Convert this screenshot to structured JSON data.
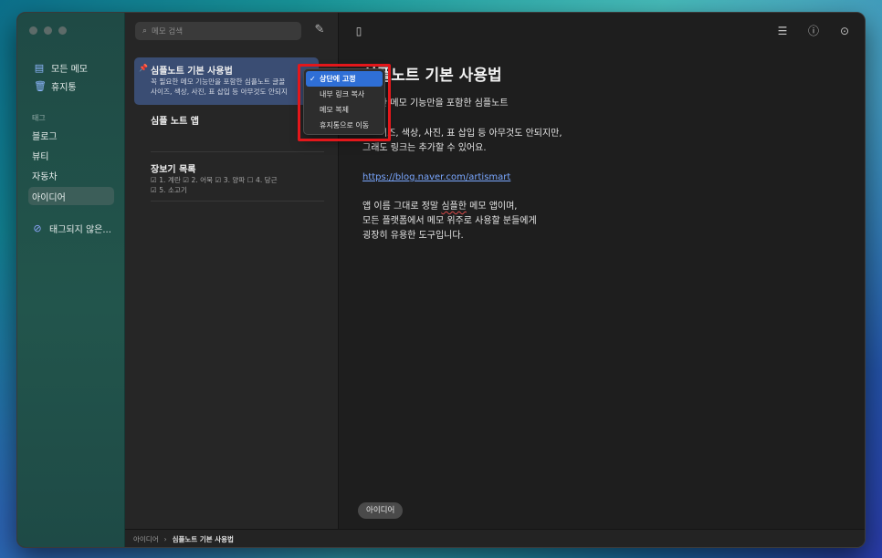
{
  "sidebar": {
    "items": [
      {
        "label": "모든 메모",
        "icon": "notes-icon"
      },
      {
        "label": "휴지통",
        "icon": "trash-icon"
      }
    ],
    "tags_heading": "태그",
    "tags": [
      "블로그",
      "뷰티",
      "자동차",
      "아이디어"
    ],
    "untagged": "태그되지 않은..."
  },
  "list": {
    "search_placeholder": "메모 검색",
    "notes": [
      {
        "title": "심플노트 기본 사용법",
        "line1": "꼭 필요한 메모 기능만을 포함한 심플노트 글꼴",
        "line2": "사이즈, 색상, 사진, 표 삽입 등 아무것도 안되지"
      },
      {
        "title": "심플 노트 앱",
        "line1": ""
      },
      {
        "title": "장보기 목록",
        "line1": "☑ 1. 계란  ☑ 2. 어묵  ☑ 3. 양파  ☐ 4. 당근",
        "line2": "☑ 5. 소고기"
      }
    ]
  },
  "editor": {
    "title": "심플노트 기본 사용법",
    "p1": "한 메모 기능만을 포함한 심플노트",
    "p2a": "이즈, 색상, 사진, 표 삽입 등 아무것도 안되지만,",
    "p2b": "그래도 링크는 추가할 수 있어요.",
    "link": "https://blog.naver.com/artismart",
    "p3a_pre": "앱 이름 그대로 정말 ",
    "p3a_squig": "심플한",
    "p3a_post": " 메모 앱이며,",
    "p3b": "모든 플랫폼에서 메모 위주로 사용할 분들에게",
    "p3c": "굉장히 유용한 도구입니다.",
    "tag": "아이디어"
  },
  "context_menu": {
    "items": [
      "상단에 고정",
      "내부 링크 복사",
      "메모 복제",
      "휴지통으로 이동"
    ],
    "checked": "✓"
  },
  "footer": {
    "parent": "아이디어",
    "sep": "›",
    "current": "심플노트 기본 사용법"
  },
  "colors": {
    "accent": "#2f6fd6",
    "highlight": "#e3171b"
  }
}
